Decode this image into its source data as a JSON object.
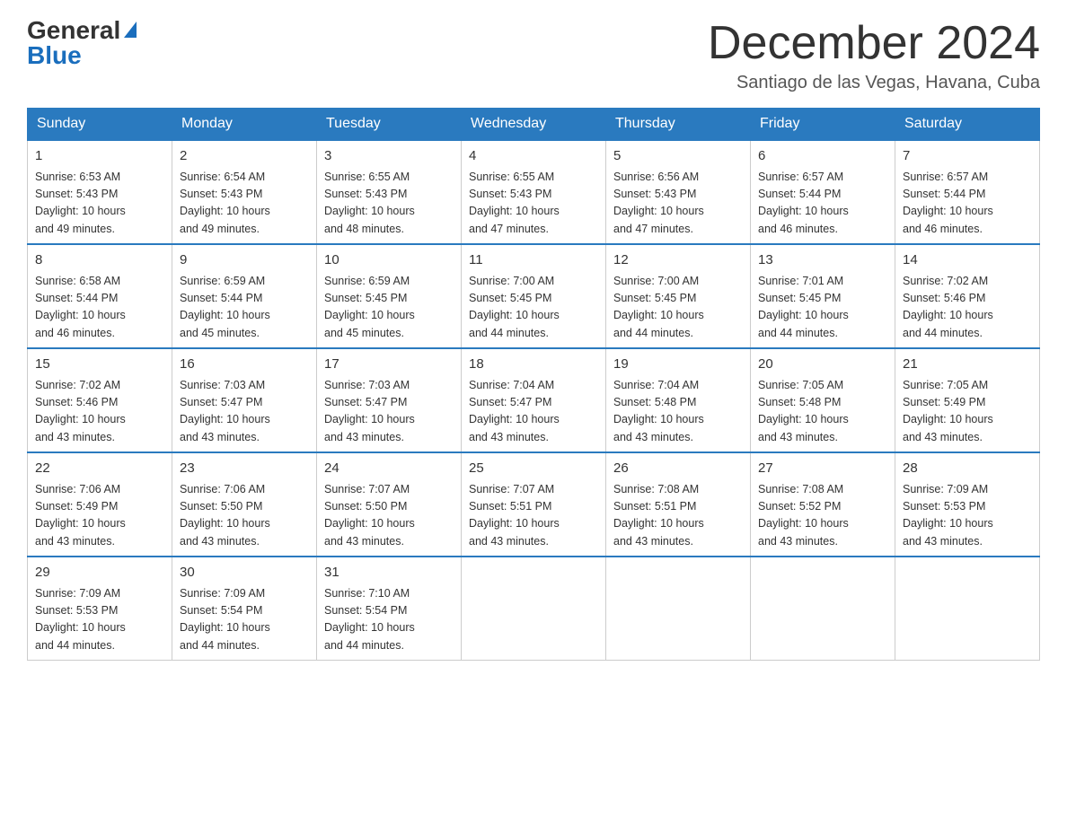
{
  "header": {
    "logo_general": "General",
    "logo_blue": "Blue",
    "month_title": "December 2024",
    "location": "Santiago de las Vegas, Havana, Cuba"
  },
  "weekdays": [
    "Sunday",
    "Monday",
    "Tuesday",
    "Wednesday",
    "Thursday",
    "Friday",
    "Saturday"
  ],
  "weeks": [
    [
      {
        "day": "1",
        "sunrise": "6:53 AM",
        "sunset": "5:43 PM",
        "daylight": "10 hours and 49 minutes."
      },
      {
        "day": "2",
        "sunrise": "6:54 AM",
        "sunset": "5:43 PM",
        "daylight": "10 hours and 49 minutes."
      },
      {
        "day": "3",
        "sunrise": "6:55 AM",
        "sunset": "5:43 PM",
        "daylight": "10 hours and 48 minutes."
      },
      {
        "day": "4",
        "sunrise": "6:55 AM",
        "sunset": "5:43 PM",
        "daylight": "10 hours and 47 minutes."
      },
      {
        "day": "5",
        "sunrise": "6:56 AM",
        "sunset": "5:43 PM",
        "daylight": "10 hours and 47 minutes."
      },
      {
        "day": "6",
        "sunrise": "6:57 AM",
        "sunset": "5:44 PM",
        "daylight": "10 hours and 46 minutes."
      },
      {
        "day": "7",
        "sunrise": "6:57 AM",
        "sunset": "5:44 PM",
        "daylight": "10 hours and 46 minutes."
      }
    ],
    [
      {
        "day": "8",
        "sunrise": "6:58 AM",
        "sunset": "5:44 PM",
        "daylight": "10 hours and 46 minutes."
      },
      {
        "day": "9",
        "sunrise": "6:59 AM",
        "sunset": "5:44 PM",
        "daylight": "10 hours and 45 minutes."
      },
      {
        "day": "10",
        "sunrise": "6:59 AM",
        "sunset": "5:45 PM",
        "daylight": "10 hours and 45 minutes."
      },
      {
        "day": "11",
        "sunrise": "7:00 AM",
        "sunset": "5:45 PM",
        "daylight": "10 hours and 44 minutes."
      },
      {
        "day": "12",
        "sunrise": "7:00 AM",
        "sunset": "5:45 PM",
        "daylight": "10 hours and 44 minutes."
      },
      {
        "day": "13",
        "sunrise": "7:01 AM",
        "sunset": "5:45 PM",
        "daylight": "10 hours and 44 minutes."
      },
      {
        "day": "14",
        "sunrise": "7:02 AM",
        "sunset": "5:46 PM",
        "daylight": "10 hours and 44 minutes."
      }
    ],
    [
      {
        "day": "15",
        "sunrise": "7:02 AM",
        "sunset": "5:46 PM",
        "daylight": "10 hours and 43 minutes."
      },
      {
        "day": "16",
        "sunrise": "7:03 AM",
        "sunset": "5:47 PM",
        "daylight": "10 hours and 43 minutes."
      },
      {
        "day": "17",
        "sunrise": "7:03 AM",
        "sunset": "5:47 PM",
        "daylight": "10 hours and 43 minutes."
      },
      {
        "day": "18",
        "sunrise": "7:04 AM",
        "sunset": "5:47 PM",
        "daylight": "10 hours and 43 minutes."
      },
      {
        "day": "19",
        "sunrise": "7:04 AM",
        "sunset": "5:48 PM",
        "daylight": "10 hours and 43 minutes."
      },
      {
        "day": "20",
        "sunrise": "7:05 AM",
        "sunset": "5:48 PM",
        "daylight": "10 hours and 43 minutes."
      },
      {
        "day": "21",
        "sunrise": "7:05 AM",
        "sunset": "5:49 PM",
        "daylight": "10 hours and 43 minutes."
      }
    ],
    [
      {
        "day": "22",
        "sunrise": "7:06 AM",
        "sunset": "5:49 PM",
        "daylight": "10 hours and 43 minutes."
      },
      {
        "day": "23",
        "sunrise": "7:06 AM",
        "sunset": "5:50 PM",
        "daylight": "10 hours and 43 minutes."
      },
      {
        "day": "24",
        "sunrise": "7:07 AM",
        "sunset": "5:50 PM",
        "daylight": "10 hours and 43 minutes."
      },
      {
        "day": "25",
        "sunrise": "7:07 AM",
        "sunset": "5:51 PM",
        "daylight": "10 hours and 43 minutes."
      },
      {
        "day": "26",
        "sunrise": "7:08 AM",
        "sunset": "5:51 PM",
        "daylight": "10 hours and 43 minutes."
      },
      {
        "day": "27",
        "sunrise": "7:08 AM",
        "sunset": "5:52 PM",
        "daylight": "10 hours and 43 minutes."
      },
      {
        "day": "28",
        "sunrise": "7:09 AM",
        "sunset": "5:53 PM",
        "daylight": "10 hours and 43 minutes."
      }
    ],
    [
      {
        "day": "29",
        "sunrise": "7:09 AM",
        "sunset": "5:53 PM",
        "daylight": "10 hours and 44 minutes."
      },
      {
        "day": "30",
        "sunrise": "7:09 AM",
        "sunset": "5:54 PM",
        "daylight": "10 hours and 44 minutes."
      },
      {
        "day": "31",
        "sunrise": "7:10 AM",
        "sunset": "5:54 PM",
        "daylight": "10 hours and 44 minutes."
      },
      null,
      null,
      null,
      null
    ]
  ],
  "labels": {
    "sunrise": "Sunrise:",
    "sunset": "Sunset:",
    "daylight": "Daylight:"
  }
}
